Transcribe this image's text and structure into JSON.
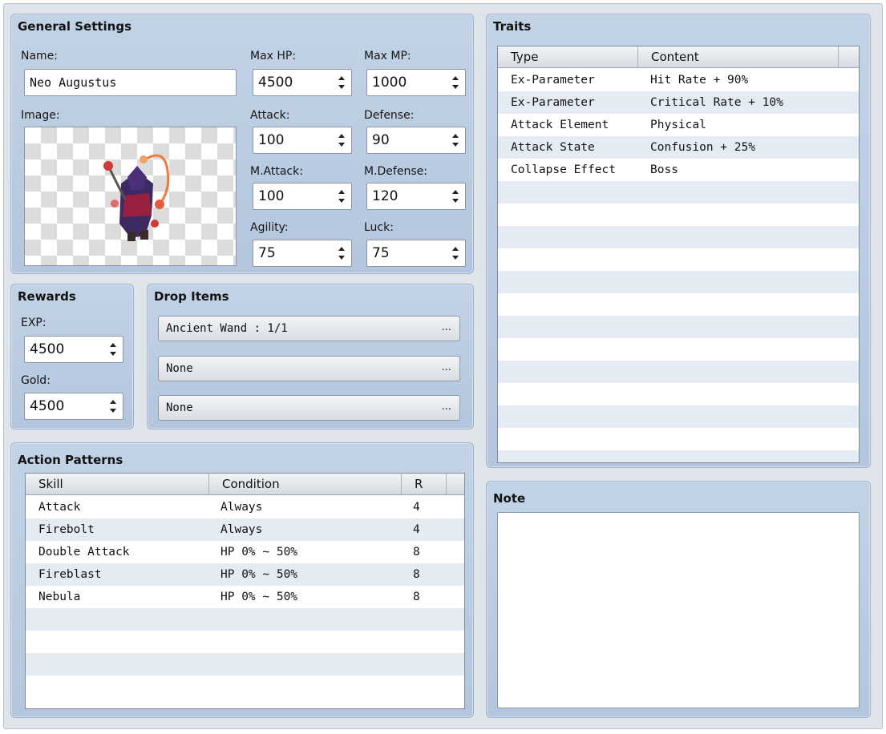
{
  "general": {
    "title": "General Settings",
    "name_label": "Name:",
    "name_value": "Neo Augustus",
    "image_label": "Image:",
    "max_hp_label": "Max HP:",
    "max_hp": "4500",
    "max_mp_label": "Max MP:",
    "max_mp": "1000",
    "attack_label": "Attack:",
    "attack": "100",
    "defense_label": "Defense:",
    "defense": "90",
    "mattack_label": "M.Attack:",
    "mattack": "100",
    "mdefense_label": "M.Defense:",
    "mdefense": "120",
    "agility_label": "Agility:",
    "agility": "75",
    "luck_label": "Luck:",
    "luck": "75"
  },
  "rewards": {
    "title": "Rewards",
    "exp_label": "EXP:",
    "exp": "4500",
    "gold_label": "Gold:",
    "gold": "4500"
  },
  "drops": {
    "title": "Drop Items",
    "items": [
      "Ancient Wand : 1/1",
      "None",
      "None"
    ],
    "more_label": "..."
  },
  "actions": {
    "title": "Action Patterns",
    "headers": [
      "Skill",
      "Condition",
      "R"
    ],
    "rows": [
      {
        "skill": "Attack",
        "condition": "Always",
        "r": "4"
      },
      {
        "skill": "Firebolt",
        "condition": "Always",
        "r": "4"
      },
      {
        "skill": "Double Attack",
        "condition": "HP 0% ~ 50%",
        "r": "8"
      },
      {
        "skill": "Fireblast",
        "condition": "HP 0% ~ 50%",
        "r": "8"
      },
      {
        "skill": "Nebula",
        "condition": "HP 0% ~ 50%",
        "r": "8"
      }
    ]
  },
  "traits": {
    "title": "Traits",
    "headers": [
      "Type",
      "Content"
    ],
    "rows": [
      {
        "type": "Ex-Parameter",
        "content": "Hit Rate + 90%"
      },
      {
        "type": "Ex-Parameter",
        "content": "Critical Rate + 10%"
      },
      {
        "type": "Attack Element",
        "content": "Physical"
      },
      {
        "type": "Attack State",
        "content": "Confusion + 25%"
      },
      {
        "type": "Collapse Effect",
        "content": "Boss"
      }
    ]
  },
  "note": {
    "title": "Note",
    "text": ""
  },
  "icons": {
    "spinner": "spinner-arrows-icon",
    "sprite": "enemy-sprite-image"
  }
}
